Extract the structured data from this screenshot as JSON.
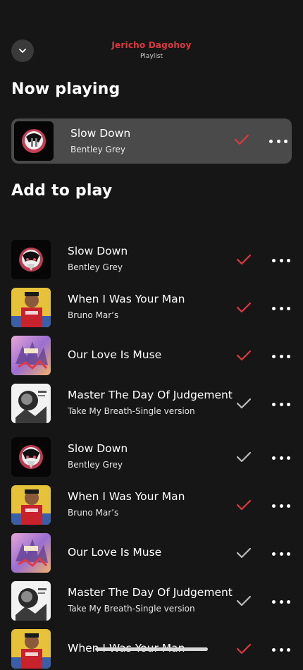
{
  "header": {
    "title": "Jericho Dagohoy",
    "subtitle": "Playlist",
    "collapse_icon": "chevron-down-icon"
  },
  "now_playing": {
    "heading": "Now playing",
    "track": {
      "title": "Slow Down",
      "artist": "Bentley Grey",
      "checked": true,
      "art": "slow-down-art"
    }
  },
  "queue": {
    "heading": "Add to play",
    "tracks": [
      {
        "title": "Slow Down",
        "artist": "Bentley Grey",
        "checked": true,
        "art": "slow"
      },
      {
        "title": "When I Was Your Man",
        "artist": "Bruno Mar’s",
        "checked": true,
        "art": "bruno"
      },
      {
        "title": "Our Love Is Muse",
        "artist": "",
        "checked": true,
        "art": "muse"
      },
      {
        "title": "Master The Day Of Judgement",
        "artist": "Take My Breath-Single version",
        "checked": false,
        "art": "master"
      },
      {
        "title": "Slow Down",
        "artist": "Bentley Grey",
        "checked": false,
        "art": "slow"
      },
      {
        "title": "When I Was Your Man",
        "artist": "Bruno Mar’s",
        "checked": true,
        "art": "bruno"
      },
      {
        "title": "Our Love Is Muse",
        "artist": "",
        "checked": false,
        "art": "muse"
      },
      {
        "title": "Master The Day Of Judgement",
        "artist": "Take My Breath-Single version",
        "checked": false,
        "art": "master"
      },
      {
        "title": "When I Was Your Man",
        "artist": "",
        "checked": true,
        "art": "bruno"
      }
    ]
  },
  "colors": {
    "background": "#161616",
    "accent_red": "#e0383e",
    "check_grey": "#bdbdbd",
    "card": "#4a4a4a"
  }
}
